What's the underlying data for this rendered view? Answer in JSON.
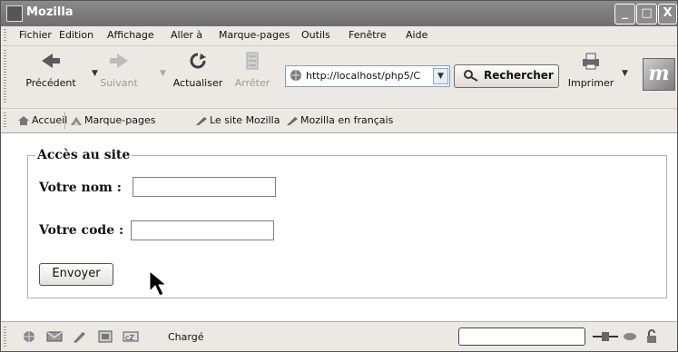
{
  "window": {
    "title": "Mozilla"
  },
  "window_buttons": {
    "minimize": "_",
    "maximize": "□",
    "close": "X"
  },
  "menu": {
    "items": [
      "Fichier",
      "Edition",
      "Affichage",
      "Aller à",
      "Marque-pages",
      "Outils",
      "Fenêtre",
      "Aide"
    ]
  },
  "nav": {
    "back": "Précédent",
    "forward": "Suivant",
    "reload": "Actualiser",
    "stop": "Arrêter",
    "url": "http://localhost/php5/C",
    "search": "Rechercher",
    "print": "Imprimer",
    "brand": "m"
  },
  "bookmarks": {
    "home": "Accueil",
    "bookmarks": "Marque-pages",
    "site": "Le site Mozilla",
    "french": "Mozilla en français"
  },
  "form": {
    "legend": "Accès au site",
    "name_label": "Votre nom :",
    "name_value": "",
    "code_label": "Votre code :",
    "code_value": "",
    "submit": "Envoyer"
  },
  "status": {
    "text": "Chargé",
    "progress": 0
  }
}
